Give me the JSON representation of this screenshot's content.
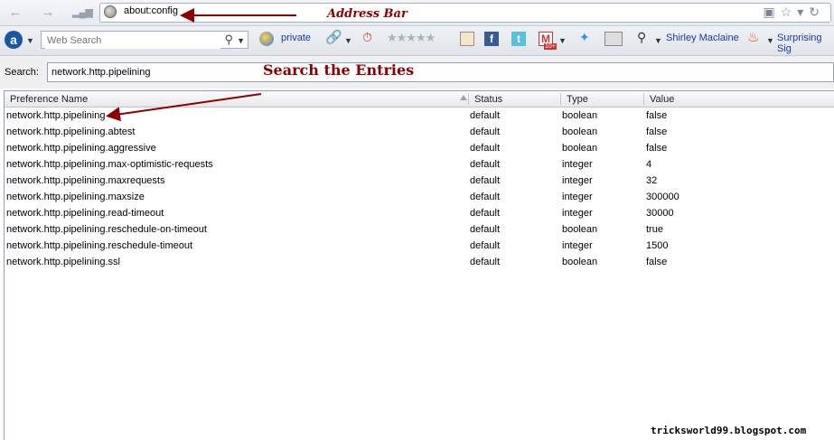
{
  "address_bar": {
    "url": "about:config"
  },
  "annotations": {
    "address_bar": "Address Bar",
    "search_entries": "Search the Entries",
    "watermark": "tricksworld99.blogspot.com"
  },
  "toolbar": {
    "web_search_placeholder": "Web Search",
    "private_label": "private",
    "user_link": "Shirley Maclaine",
    "surprising_link": "Surprising Sig",
    "gmail_badge": "10+"
  },
  "search": {
    "label": "Search:",
    "value": "network.http.pipelining"
  },
  "columns": [
    "Preference Name",
    "Status",
    "Type",
    "Value"
  ],
  "rows": [
    {
      "name": "network.http.pipelining",
      "status": "default",
      "type": "boolean",
      "value": "false"
    },
    {
      "name": "network.http.pipelining.abtest",
      "status": "default",
      "type": "boolean",
      "value": "false"
    },
    {
      "name": "network.http.pipelining.aggressive",
      "status": "default",
      "type": "boolean",
      "value": "false"
    },
    {
      "name": "network.http.pipelining.max-optimistic-requests",
      "status": "default",
      "type": "integer",
      "value": "4"
    },
    {
      "name": "network.http.pipelining.maxrequests",
      "status": "default",
      "type": "integer",
      "value": "32"
    },
    {
      "name": "network.http.pipelining.maxsize",
      "status": "default",
      "type": "integer",
      "value": "300000"
    },
    {
      "name": "network.http.pipelining.read-timeout",
      "status": "default",
      "type": "integer",
      "value": "30000"
    },
    {
      "name": "network.http.pipelining.reschedule-on-timeout",
      "status": "default",
      "type": "boolean",
      "value": "true"
    },
    {
      "name": "network.http.pipelining.reschedule-timeout",
      "status": "default",
      "type": "integer",
      "value": "1500"
    },
    {
      "name": "network.http.pipelining.ssl",
      "status": "default",
      "type": "boolean",
      "value": "false"
    }
  ],
  "colors": {
    "annotation": "#8b0000",
    "link": "#1a3a9a"
  }
}
